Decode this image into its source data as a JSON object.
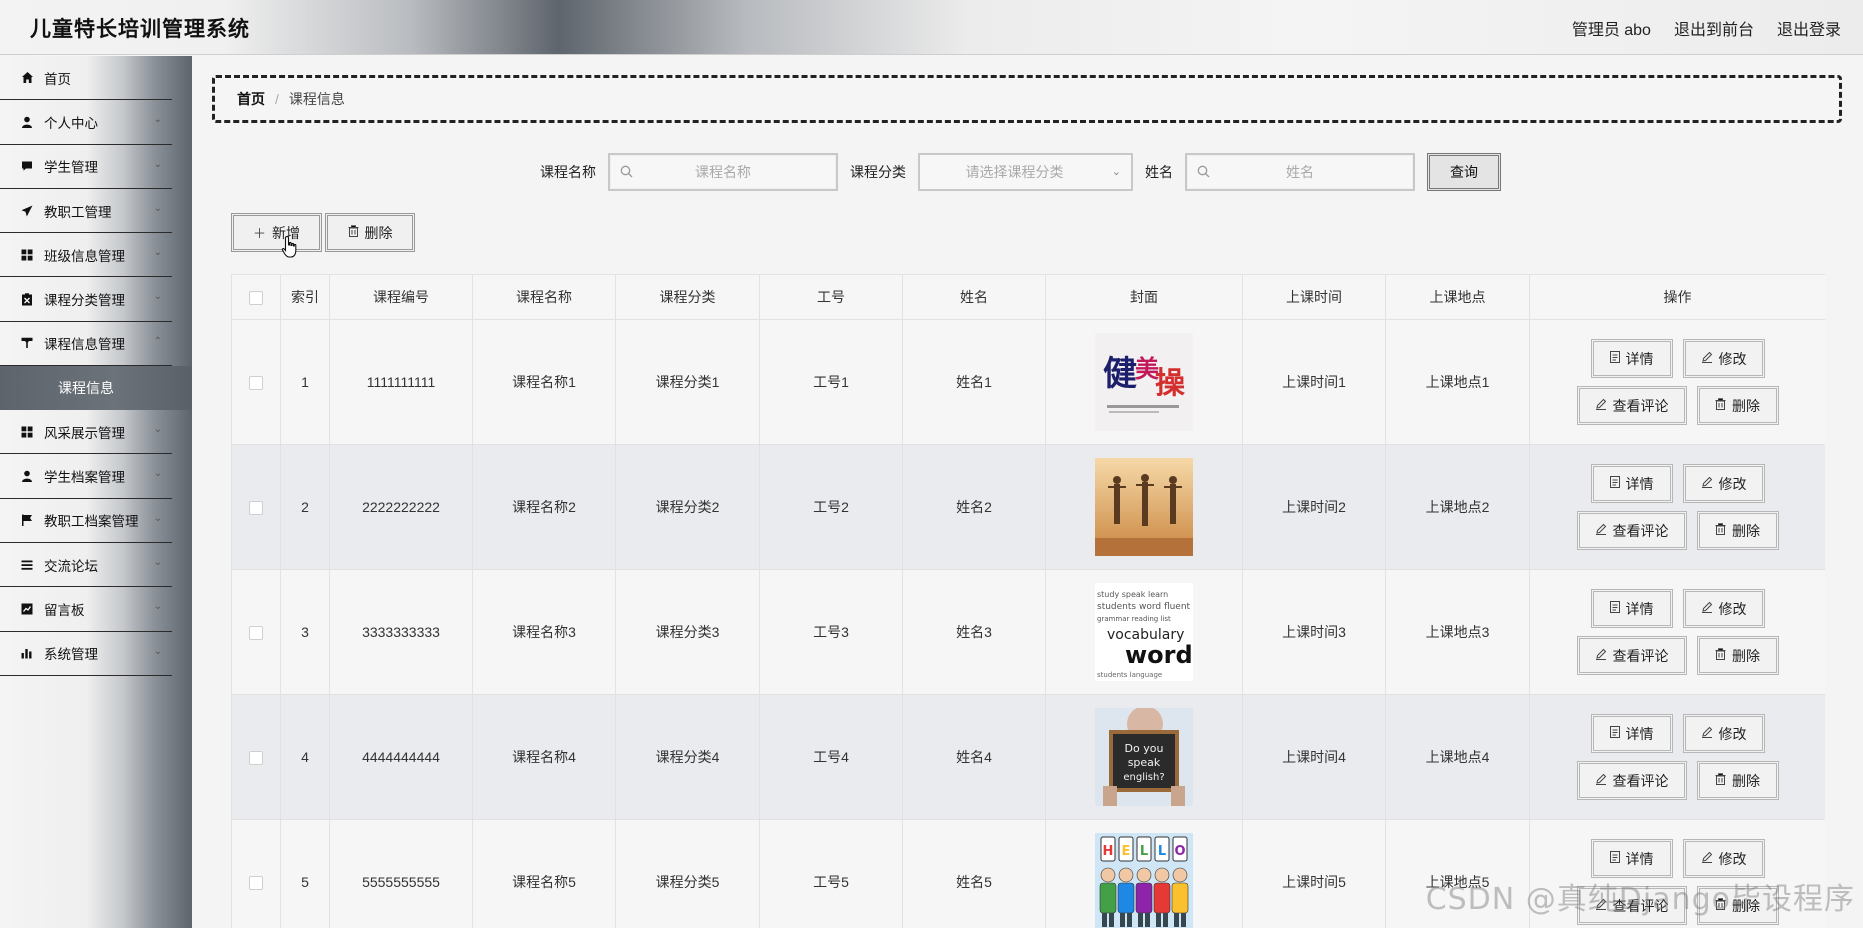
{
  "header": {
    "app_title": "儿童特长培训管理系统",
    "admin_label": "管理员 abo",
    "exit_front": "退出到前台",
    "logout": "退出登录"
  },
  "sidebar": {
    "items": [
      {
        "label": "首页",
        "icon": "home-icon",
        "has_children": false
      },
      {
        "label": "个人中心",
        "icon": "user-icon",
        "has_children": true
      },
      {
        "label": "学生管理",
        "icon": "message-icon",
        "has_children": true
      },
      {
        "label": "教职工管理",
        "icon": "send-icon",
        "has_children": true
      },
      {
        "label": "班级信息管理",
        "icon": "grid-icon",
        "has_children": true
      },
      {
        "label": "课程分类管理",
        "icon": "clipboard-icon",
        "has_children": true
      },
      {
        "label": "课程信息管理",
        "icon": "funnel-icon",
        "has_children": true
      },
      {
        "label": "风采展示管理",
        "icon": "grid-icon",
        "has_children": true
      },
      {
        "label": "学生档案管理",
        "icon": "user-icon",
        "has_children": true
      },
      {
        "label": "教职工档案管理",
        "icon": "flag-icon",
        "has_children": true
      },
      {
        "label": "交流论坛",
        "icon": "list-icon",
        "has_children": true
      },
      {
        "label": "留言板",
        "icon": "chart-icon",
        "has_children": true
      },
      {
        "label": "系统管理",
        "icon": "bar-chart-icon",
        "has_children": true
      }
    ],
    "active_sub": "课程信息"
  },
  "breadcrumb": {
    "home": "首页",
    "separator": "/",
    "current": "课程信息"
  },
  "search": {
    "name_label": "课程名称",
    "name_placeholder": "课程名称",
    "category_label": "课程分类",
    "category_placeholder": "请选择课程分类",
    "person_label": "姓名",
    "person_placeholder": "姓名",
    "query_button": "查询"
  },
  "actions": {
    "add": "新增",
    "delete": "删除"
  },
  "table": {
    "headers": [
      "索引",
      "课程编号",
      "课程名称",
      "课程分类",
      "工号",
      "姓名",
      "封面",
      "上课时间",
      "上课地点",
      "操作"
    ],
    "rows": [
      {
        "index": "1",
        "code": "1111111111",
        "name": "课程名称1",
        "category": "课程分类1",
        "staff_no": "工号1",
        "person": "姓名1",
        "time": "上课时间1",
        "place": "上课地点1",
        "cover_text": "健美操"
      },
      {
        "index": "2",
        "code": "2222222222",
        "name": "课程名称2",
        "category": "课程分类2",
        "staff_no": "工号2",
        "person": "姓名2",
        "time": "上课时间2",
        "place": "上课地点2",
        "cover_text": ""
      },
      {
        "index": "3",
        "code": "3333333333",
        "name": "课程名称3",
        "category": "课程分类3",
        "staff_no": "工号3",
        "person": "姓名3",
        "time": "上课时间3",
        "place": "上课地点3",
        "cover_text": "vocabulary words"
      },
      {
        "index": "4",
        "code": "4444444444",
        "name": "课程名称4",
        "category": "课程分类4",
        "staff_no": "工号4",
        "person": "姓名4",
        "time": "上课时间4",
        "place": "上课地点4",
        "cover_text": "Do you speak english?"
      },
      {
        "index": "5",
        "code": "5555555555",
        "name": "课程名称5",
        "category": "课程分类5",
        "staff_no": "工号5",
        "person": "姓名5",
        "time": "上课时间5",
        "place": "上课地点5",
        "cover_text": "HELLO"
      }
    ],
    "op_labels": {
      "detail": "详情",
      "edit": "修改",
      "comments": "查看评论",
      "delete": "删除"
    }
  },
  "watermark": "CSDN @真纯Django毕设程序"
}
